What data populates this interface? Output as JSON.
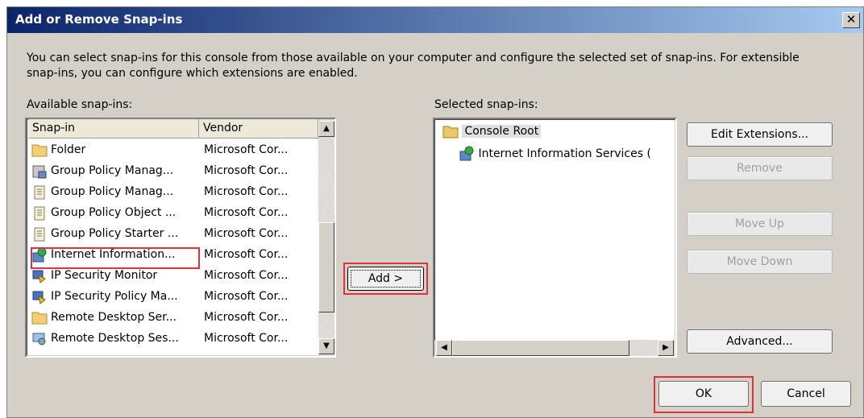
{
  "window": {
    "title": "Add or Remove Snap-ins"
  },
  "description": "You can select snap-ins for this console from those available on your computer and configure the selected set of snap-ins. For extensible snap-ins, you can configure which extensions are enabled.",
  "available": {
    "label": "Available snap-ins:",
    "columns": [
      "Snap-in",
      "Vendor"
    ],
    "rows": [
      {
        "name": "Folder",
        "vendor": "Microsoft Cor...",
        "icon": "folder-icon"
      },
      {
        "name": "Group Policy Manag...",
        "vendor": "Microsoft Cor...",
        "icon": "gpo-management-icon"
      },
      {
        "name": "Group Policy Manag...",
        "vendor": "Microsoft Cor...",
        "icon": "gpo-scroll-icon"
      },
      {
        "name": "Group Policy Object ...",
        "vendor": "Microsoft Cor...",
        "icon": "gpo-scroll-icon"
      },
      {
        "name": "Group Policy Starter ...",
        "vendor": "Microsoft Cor...",
        "icon": "gpo-scroll-icon"
      },
      {
        "name": "Internet Information...",
        "vendor": "Microsoft Cor...",
        "icon": "iis-icon"
      },
      {
        "name": "IP Security Monitor",
        "vendor": "Microsoft Cor...",
        "icon": "ip-security-icon"
      },
      {
        "name": "IP Security Policy Ma...",
        "vendor": "Microsoft Cor...",
        "icon": "ip-security-icon"
      },
      {
        "name": "Remote Desktop Ser...",
        "vendor": "Microsoft Cor...",
        "icon": "folder-icon"
      },
      {
        "name": "Remote Desktop Ses...",
        "vendor": "Microsoft Cor...",
        "icon": "remote-desktop-icon"
      }
    ]
  },
  "add_button": "Add >",
  "selected": {
    "label": "Selected snap-ins:",
    "root": "Console Root",
    "child": "Internet Information Services ("
  },
  "buttons": {
    "edit_extensions": "Edit Extensions...",
    "remove": "Remove",
    "move_up": "Move Up",
    "move_down": "Move Down",
    "advanced": "Advanced...",
    "ok": "OK",
    "cancel": "Cancel"
  },
  "colors": {
    "highlight": "#e0313c",
    "title_start": "#0a246a",
    "title_end": "#a6caf0"
  }
}
